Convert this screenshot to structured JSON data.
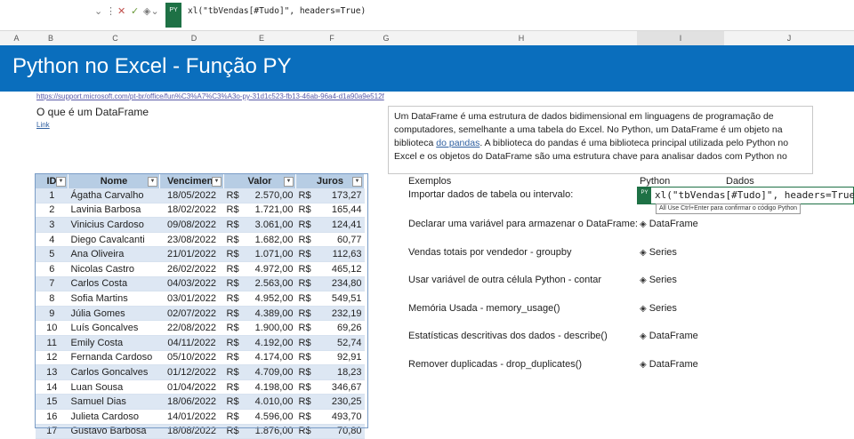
{
  "formula_bar": {
    "formula": "xl(\"tbVendas[#Tudo]\", headers=True)",
    "py_badge": "PY",
    "icons": [
      "chevron-down-icon",
      "more-icon",
      "cancel-icon",
      "confirm-icon",
      "python-object-icon"
    ]
  },
  "columns": [
    "A",
    "B",
    "C",
    "D",
    "E",
    "F",
    "G",
    "H",
    "I",
    "J"
  ],
  "banner": {
    "title": "Python no Excel - Função PY"
  },
  "link_url": "https://support.microsoft.com/pt-br/office/fun%C3%A7%C3%A3o-py-31d1c523-fb13-46ab-96a4-d1a90a9e512f",
  "question": "O que é um DataFrame",
  "link_text": "Link",
  "description": {
    "part1": "Um DataFrame é uma estrutura de dados bidimensional em linguagens de programação de computadores, semelhante a uma tabela do Excel. No Python, um DataFrame é um objeto na biblioteca ",
    "link": "do pandas",
    "part2": ". A biblioteca do pandas é uma biblioteca principal utilizada pelo Python no Excel e os objetos do DataFrame são uma estrutura chave para analisar dados com Python no"
  },
  "table": {
    "headers": [
      "ID",
      "Nome",
      "Venciment",
      "Valor",
      "Juros"
    ],
    "currency": "R$",
    "rows": [
      [
        "1",
        "Ágatha Carvalho",
        "18/05/2022",
        "2.570,00",
        "173,27"
      ],
      [
        "2",
        "Lavinia Barbosa",
        "18/02/2022",
        "1.721,00",
        "165,44"
      ],
      [
        "3",
        "Vinicius Cardoso",
        "09/08/2022",
        "3.061,00",
        "124,41"
      ],
      [
        "4",
        "Diego Cavalcanti",
        "23/08/2022",
        "1.682,00",
        "60,77"
      ],
      [
        "5",
        "Ana Oliveira",
        "21/01/2022",
        "1.071,00",
        "112,63"
      ],
      [
        "6",
        "Nicolas Castro",
        "26/02/2022",
        "4.972,00",
        "465,12"
      ],
      [
        "7",
        "Carlos Costa",
        "04/03/2022",
        "2.563,00",
        "234,80"
      ],
      [
        "8",
        "Sofia Martins",
        "03/01/2022",
        "4.952,00",
        "549,51"
      ],
      [
        "9",
        "Júlia Gomes",
        "02/07/2022",
        "4.389,00",
        "232,19"
      ],
      [
        "10",
        "Luís Goncalves",
        "22/08/2022",
        "1.900,00",
        "69,26"
      ],
      [
        "11",
        "Emily Costa",
        "04/11/2022",
        "4.192,00",
        "52,74"
      ],
      [
        "12",
        "Fernanda Cardoso",
        "05/10/2022",
        "4.174,00",
        "92,91"
      ],
      [
        "13",
        "Carlos Goncalves",
        "01/12/2022",
        "4.709,00",
        "18,23"
      ],
      [
        "14",
        "Luan Sousa",
        "01/04/2022",
        "4.198,00",
        "346,67"
      ],
      [
        "15",
        "Samuel Dias",
        "18/06/2022",
        "4.010,00",
        "230,25"
      ],
      [
        "16",
        "Julieta Cardoso",
        "14/01/2022",
        "4.596,00",
        "493,70"
      ],
      [
        "17",
        "Gustavo Barbosa",
        "18/08/2022",
        "1.876,00",
        "70,80"
      ]
    ]
  },
  "examples": {
    "header_exemplos": "Exemplos",
    "header_python": "Python",
    "header_dados": "Dados",
    "edit_code": "xl(\"tbVendas[#Tudo]\", headers=True)",
    "edit_badge": "PY",
    "tooltip": "All Use Ctrl+Enter para confirmar o código Python",
    "items": [
      {
        "label": "Importar dados de tabela ou intervalo:",
        "type": ""
      },
      {
        "label": "Declarar uma variável para armazenar o DataFrame:",
        "type": "DataFrame"
      },
      {
        "label": "Vendas totais por vendedor - groupby",
        "type": "Series"
      },
      {
        "label": "Usar variável de outra célula Python - contar",
        "type": "Series"
      },
      {
        "label": "Memória Usada - memory_usage()",
        "type": "Series"
      },
      {
        "label": "Estatísticas descritivas dos dados - describe()",
        "type": "DataFrame"
      },
      {
        "label": "Remover duplicadas - drop_duplicates()",
        "type": "DataFrame"
      }
    ]
  }
}
